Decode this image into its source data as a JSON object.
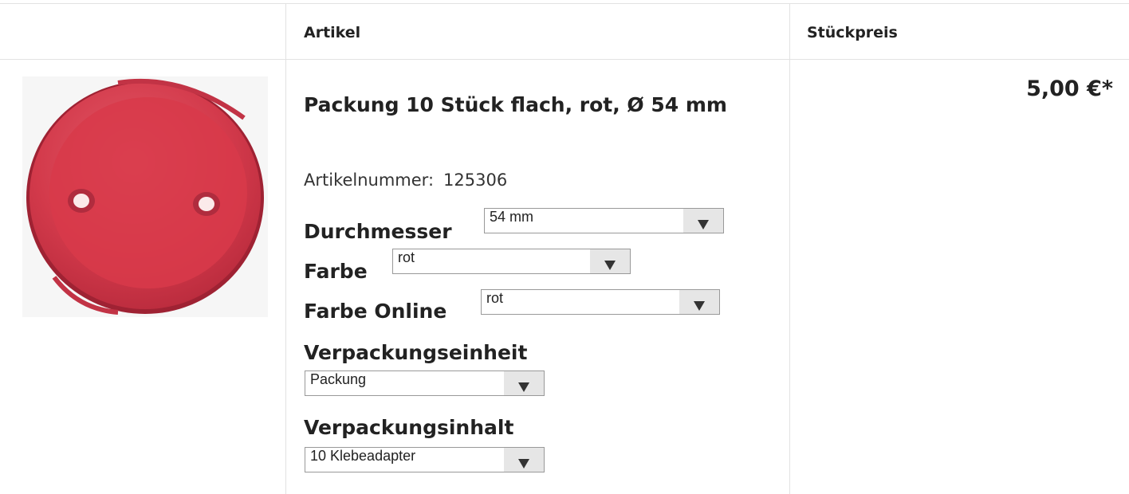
{
  "table": {
    "headers": {
      "article": "Artikel",
      "price": "Stückpreis"
    }
  },
  "product": {
    "image_alt": "red round adhesive adapter",
    "title": "Packung 10 Stück flach, rot, Ø 54 mm",
    "article_number_label": "Artikelnummer:",
    "article_number": "125306",
    "price": "5,00 €*",
    "options": [
      {
        "label": "Durchmesser",
        "value": "54 mm"
      },
      {
        "label": "Farbe",
        "value": "rot"
      },
      {
        "label": "Farbe Online",
        "value": "rot"
      },
      {
        "label": "Verpackungseinheit",
        "value": "Packung"
      },
      {
        "label": "Verpackungsinhalt",
        "value": "10 Klebeadapter"
      }
    ]
  },
  "colors": {
    "product": "#d8394a",
    "border": "#e2e2e2",
    "select_button": "#e6e6e6"
  },
  "icons": {
    "dropdown": "triangle-down-icon"
  }
}
